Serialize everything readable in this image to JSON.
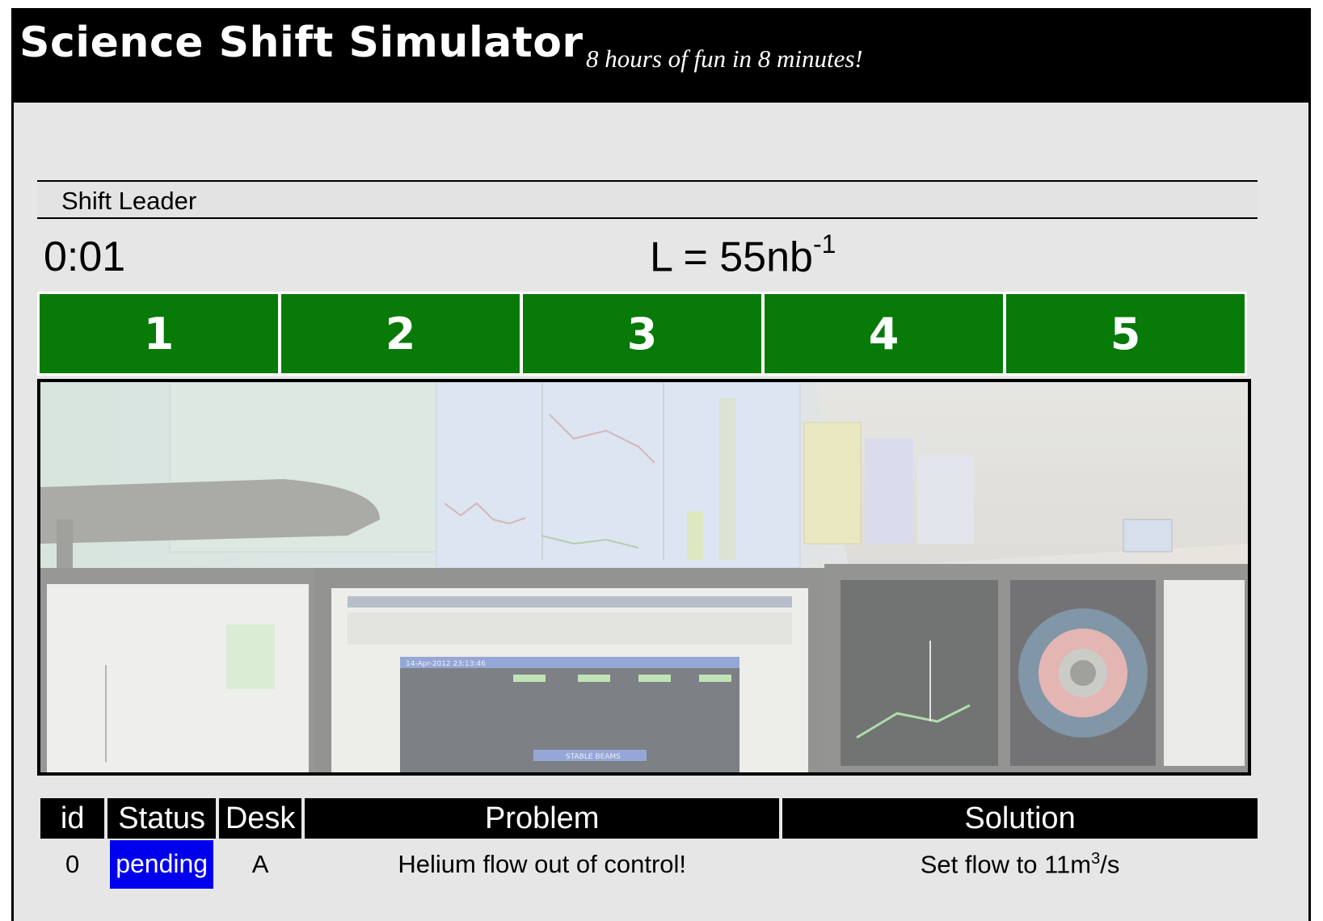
{
  "header": {
    "title": "Science Shift Simulator",
    "tagline": "8 hours of fun in 8 minutes!"
  },
  "role": {
    "label": "Shift Leader"
  },
  "status": {
    "clock": "0:01",
    "luminosity_prefix": "L = 55nb",
    "luminosity_exponent": "-1"
  },
  "desks": [
    "1",
    "2",
    "3",
    "4",
    "5"
  ],
  "colors": {
    "desk_green": "#077a07",
    "pending_blue": "#0000ee",
    "header_black": "#000000",
    "background": "#e6e6e6"
  },
  "control_room_image": {
    "screen_readout_title": "14-Apr-2012 23:13:46",
    "screen_readout_status": "STABLE BEAMS"
  },
  "table": {
    "headers": [
      "id",
      "Status",
      "Desk",
      "Problem",
      "Solution"
    ],
    "rows": [
      {
        "id": "0",
        "status": "pending",
        "desk": "A",
        "problem": "Helium flow out of control!",
        "solution_prefix": "Set flow to 11m",
        "solution_exponent": "3",
        "solution_suffix": "/s"
      }
    ]
  }
}
